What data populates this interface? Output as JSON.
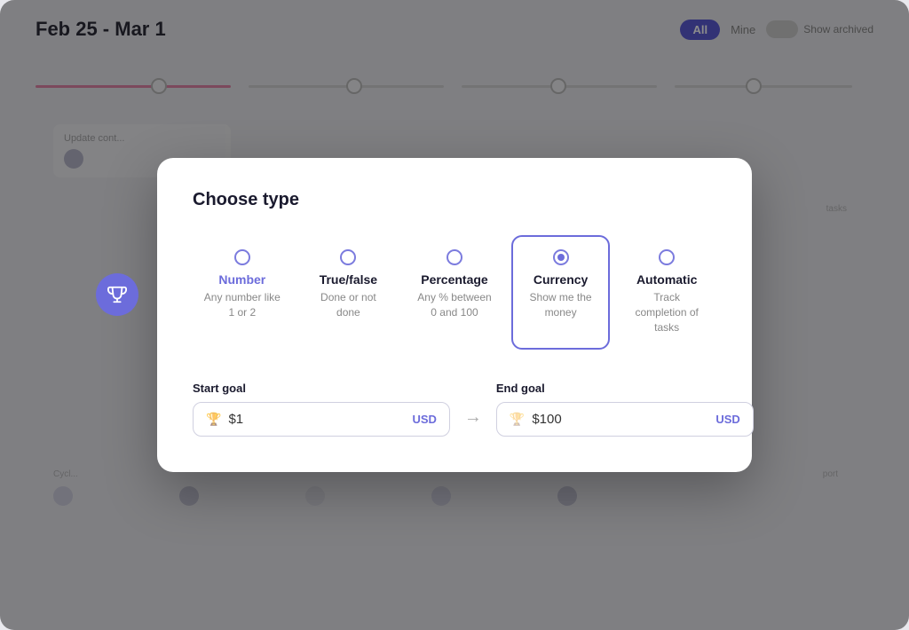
{
  "page": {
    "date_range": "Feb 25 - Mar 1",
    "filter_all": "All",
    "filter_mine": "Mine",
    "show_archived_label": "Show archived"
  },
  "modal": {
    "title": "Choose type",
    "type_options": [
      {
        "id": "number",
        "label": "Number",
        "description": "Any number like 1 or 2",
        "selected": false
      },
      {
        "id": "true_false",
        "label": "True/false",
        "description": "Done or not done",
        "selected": false
      },
      {
        "id": "percentage",
        "label": "Percentage",
        "description": "Any % between 0 and 100",
        "selected": false
      },
      {
        "id": "currency",
        "label": "Currency",
        "description": "Show me the money",
        "selected": true
      },
      {
        "id": "automatic",
        "label": "Automatic",
        "description": "Track completion of tasks",
        "selected": false
      }
    ],
    "start_goal": {
      "label": "Start goal",
      "value": "$1",
      "currency": "USD"
    },
    "end_goal": {
      "label": "End goal",
      "value": "$100",
      "currency": "USD"
    },
    "arrow_icon": "→"
  },
  "background": {
    "card1_text": "Update cont...",
    "card2_text": "...",
    "card3_text": "tasks"
  }
}
